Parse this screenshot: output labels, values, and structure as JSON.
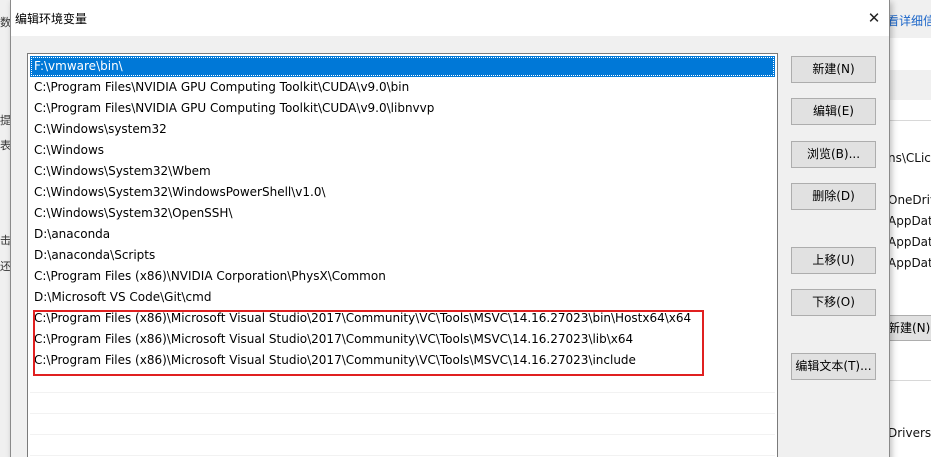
{
  "background": {
    "left_chars": [
      "数",
      "提",
      "表",
      "击",
      "还"
    ],
    "right_link": "看详细信",
    "right_texts": [
      "ns\\CLic",
      "OneDriv",
      "AppDat",
      "AppDat",
      "AppDat",
      "Drivers\\"
    ],
    "right_button": "新建(N)..."
  },
  "dialog": {
    "title": "编辑环境变量",
    "close_glyph": "✕"
  },
  "paths": [
    "F:\\vmware\\bin\\",
    "C:\\Program Files\\NVIDIA GPU Computing Toolkit\\CUDA\\v9.0\\bin",
    "C:\\Program Files\\NVIDIA GPU Computing Toolkit\\CUDA\\v9.0\\libnvvp",
    "C:\\Windows\\system32",
    "C:\\Windows",
    "C:\\Windows\\System32\\Wbem",
    "C:\\Windows\\System32\\WindowsPowerShell\\v1.0\\",
    "C:\\Windows\\System32\\OpenSSH\\",
    "D:\\anaconda",
    "D:\\anaconda\\Scripts",
    "C:\\Program Files (x86)\\NVIDIA Corporation\\PhysX\\Common",
    "D:\\Microsoft VS Code\\Git\\cmd",
    "C:\\Program Files (x86)\\Microsoft Visual Studio\\2017\\Community\\VC\\Tools\\MSVC\\14.16.27023\\bin\\Hostx64\\x64",
    "C:\\Program Files (x86)\\Microsoft Visual Studio\\2017\\Community\\VC\\Tools\\MSVC\\14.16.27023\\lib\\x64",
    "C:\\Program Files (x86)\\Microsoft Visual Studio\\2017\\Community\\VC\\Tools\\MSVC\\14.16.27023\\include"
  ],
  "buttons": {
    "new": "新建(N)",
    "edit": "编辑(E)",
    "browse": "浏览(B)...",
    "delete": "删除(D)",
    "move_up": "上移(U)",
    "move_down": "下移(O)",
    "edit_text": "编辑文本(T)..."
  },
  "colors": {
    "selection": "#0078d7",
    "highlight_border": "#e02020"
  }
}
